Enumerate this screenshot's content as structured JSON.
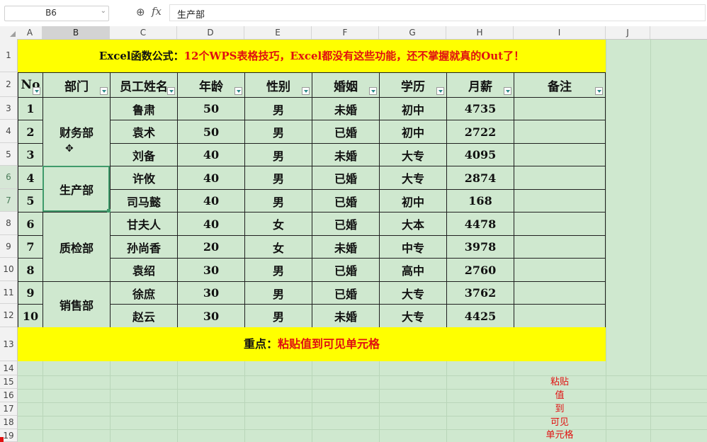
{
  "formula_bar": {
    "cell_ref": "B6",
    "zoom_icon": "zoom-icon",
    "fx_label": "fx",
    "content": "生产部"
  },
  "columns": [
    "A",
    "B",
    "C",
    "D",
    "E",
    "F",
    "G",
    "H",
    "I",
    "J"
  ],
  "rows": [
    "1",
    "2",
    "3",
    "4",
    "5",
    "6",
    "7",
    "8",
    "9",
    "10",
    "11",
    "12",
    "13",
    "14",
    "15",
    "16",
    "17",
    "18",
    "19"
  ],
  "title": {
    "black_part": "Excel函数公式：",
    "red_part": "12个WPS表格技巧，Excel都没有这些功能，还不掌握就真的Out了！"
  },
  "table": {
    "headers": [
      "No",
      "部门",
      "员工姓名",
      "年龄",
      "性别",
      "婚姻",
      "学历",
      "月薪",
      "备注"
    ],
    "departments": [
      "财务部",
      "生产部",
      "质检部",
      "销售部"
    ],
    "rows": [
      [
        "1",
        "鲁肃",
        "50",
        "男",
        "未婚",
        "初中",
        "4735",
        ""
      ],
      [
        "2",
        "袁术",
        "50",
        "男",
        "已婚",
        "初中",
        "2722",
        ""
      ],
      [
        "3",
        "刘备",
        "40",
        "男",
        "未婚",
        "大专",
        "4095",
        ""
      ],
      [
        "4",
        "许攸",
        "40",
        "男",
        "已婚",
        "大专",
        "2874",
        ""
      ],
      [
        "5",
        "司马懿",
        "40",
        "男",
        "已婚",
        "初中",
        "168",
        ""
      ],
      [
        "6",
        "甘夫人",
        "40",
        "女",
        "已婚",
        "大本",
        "4478",
        ""
      ],
      [
        "7",
        "孙尚香",
        "20",
        "女",
        "未婚",
        "中专",
        "3978",
        ""
      ],
      [
        "8",
        "袁绍",
        "30",
        "男",
        "已婚",
        "高中",
        "2760",
        ""
      ],
      [
        "9",
        "徐庶",
        "30",
        "男",
        "已婚",
        "大专",
        "3762",
        ""
      ],
      [
        "10",
        "赵云",
        "30",
        "男",
        "未婚",
        "大专",
        "4425",
        ""
      ]
    ]
  },
  "key_point": {
    "black_part": "重点：",
    "red_part": "粘贴值到可见单元格"
  },
  "side_notes": [
    "粘贴",
    "值",
    "到",
    "可见",
    "单元格"
  ],
  "colors": {
    "sheet_background": "#cfe8cf",
    "highlight_yellow": "#ffff00",
    "accent_red": "#e01010",
    "selection_green": "#3f9b6b"
  }
}
